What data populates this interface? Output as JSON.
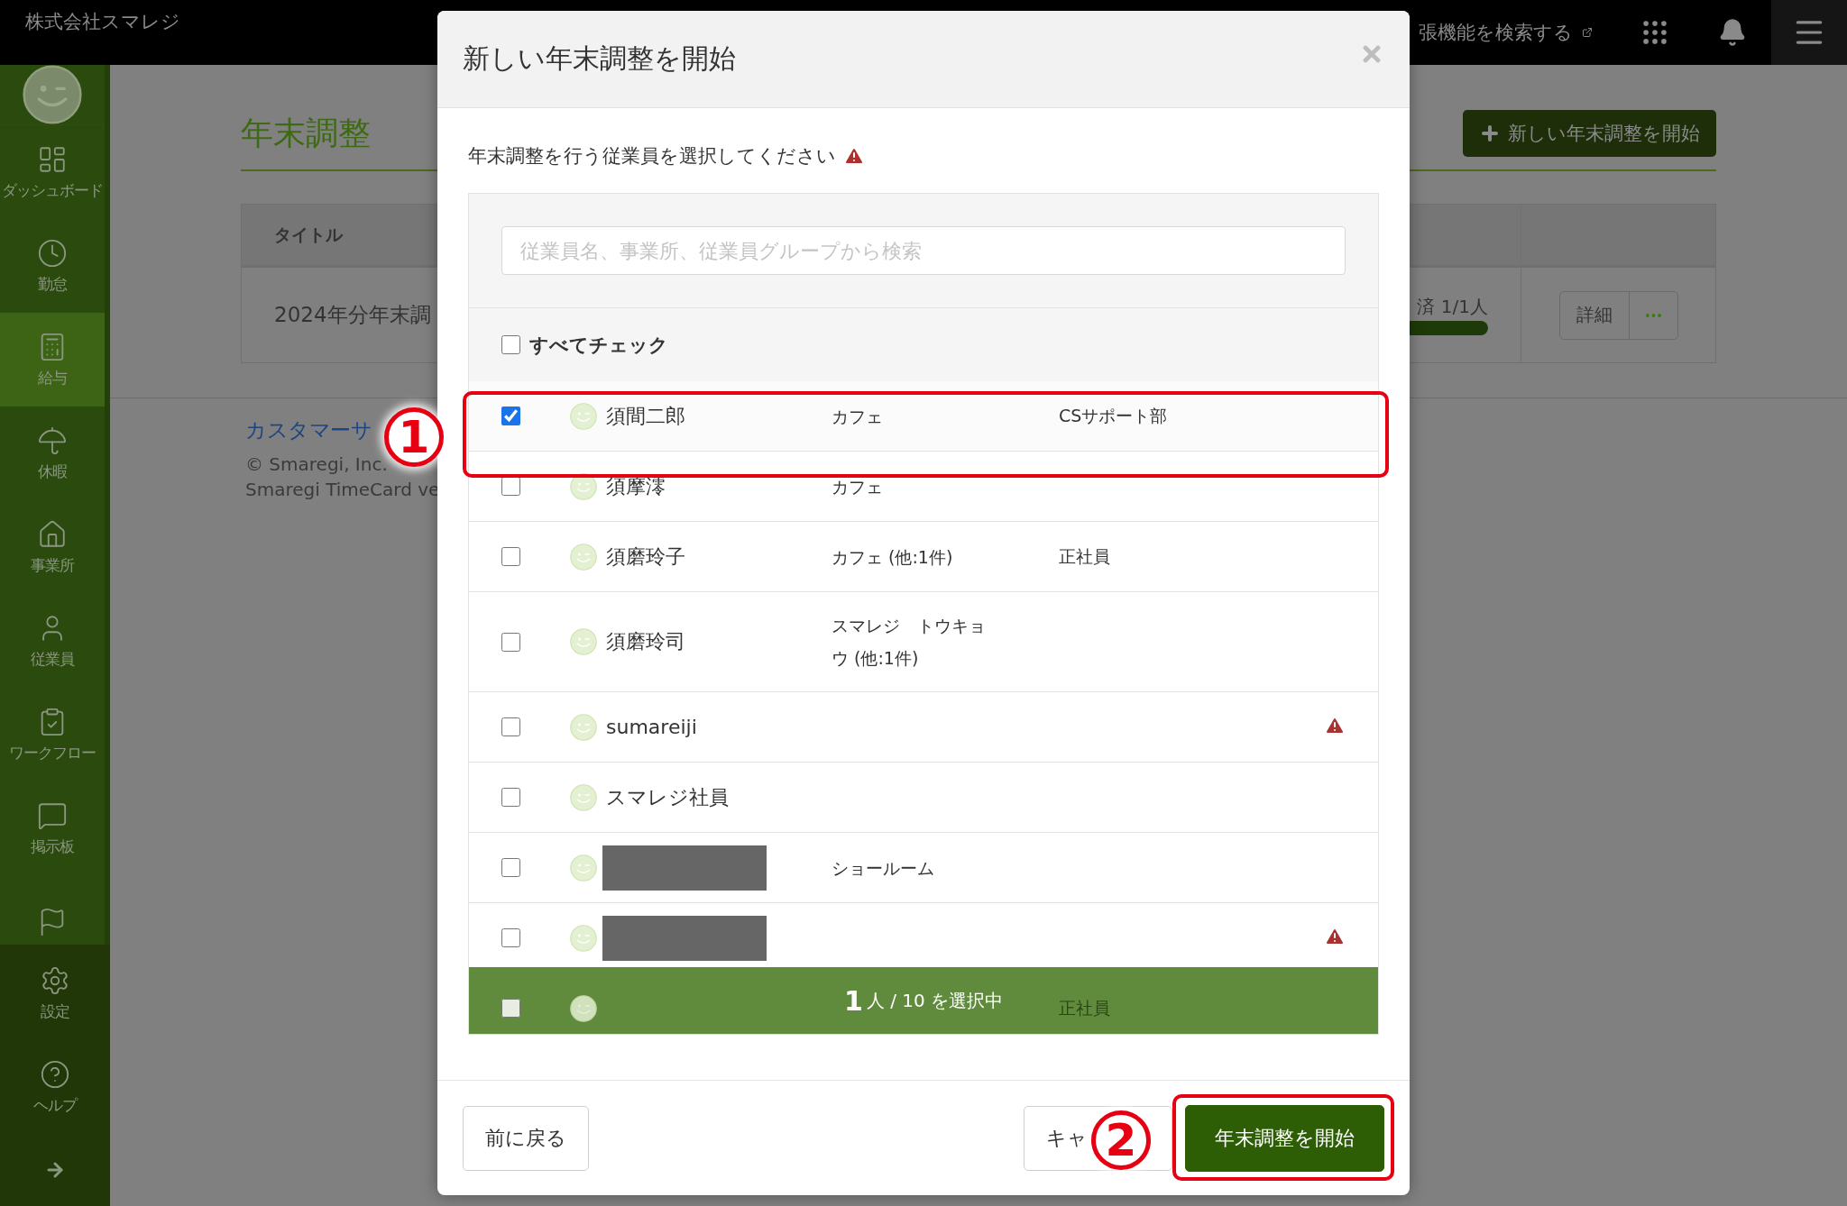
{
  "topbar": {
    "company": "株式会社スマレジ",
    "extension_search": "張機能を検索する"
  },
  "sidebar": {
    "items": [
      {
        "label": "ダッシュボード",
        "selected": false
      },
      {
        "label": "勤怠",
        "selected": false
      },
      {
        "label": "給与",
        "selected": true
      },
      {
        "label": "休暇",
        "selected": false
      },
      {
        "label": "事業所",
        "selected": false
      },
      {
        "label": "従業員",
        "selected": false
      },
      {
        "label": "ワークフロー",
        "selected": false
      },
      {
        "label": "掲示板",
        "selected": false
      }
    ],
    "bottom_items": [
      {
        "label": "設定"
      },
      {
        "label": "ヘルプ"
      }
    ]
  },
  "page": {
    "title": "年末調整",
    "new_button": "新しい年末調整を開始",
    "table": {
      "columns": [
        "タイトル"
      ],
      "rows": [
        {
          "title": "2024年分年末調",
          "progress_text": "済 1/1人",
          "level": 1,
          "detail_button": "詳細"
        }
      ]
    },
    "footer": {
      "support_link": "カスタマーサ",
      "copyright": "© Smaregi, Inc.",
      "version": "Smaregi TimeCard ve"
    }
  },
  "modal": {
    "title": "新しい年末調整を開始",
    "instruction": "年末調整を行う従業員を選択してください",
    "search": {
      "placeholder": "従業員名、事業所、従業員グループから検索"
    },
    "check_all": {
      "label": "すべてチェック",
      "checked": false
    },
    "employees": [
      {
        "kind": "named",
        "checked": true,
        "name": "須間二郎",
        "store": "カフェ",
        "group": "CSサポート部",
        "warning": false
      },
      {
        "kind": "named",
        "checked": false,
        "name": "須摩澪",
        "store": "カフェ",
        "warning": false
      },
      {
        "kind": "named",
        "checked": false,
        "name": "須磨玲子",
        "store": "カフェ (他:1件)",
        "group": "正社員",
        "warning": false
      },
      {
        "kind": "named",
        "checked": false,
        "name": "須磨玲司",
        "store": "スマレジ　トウキョウ (他:1件)",
        "warning": false
      },
      {
        "kind": "named",
        "checked": false,
        "name": "sumareiji",
        "warning": true
      },
      {
        "kind": "named",
        "checked": false,
        "name": "スマレジ社員",
        "warning": false
      },
      {
        "kind": "redacted",
        "checked": false,
        "store": "ショールーム",
        "warning": false
      },
      {
        "kind": "redacted",
        "checked": false,
        "warning": true
      },
      {
        "kind": "covered",
        "checked": false,
        "group": "正社員",
        "warning": false
      }
    ],
    "selection_summary": {
      "count": "1",
      "text": "人 / 10 を選択中"
    },
    "buttons": {
      "back": "前に戻る",
      "cancel": "キャ",
      "start": "年末調整を開始"
    }
  },
  "annotations": [
    {
      "kind": "frame"
    },
    {
      "kind": "marker",
      "label": "1"
    },
    {
      "kind": "frame"
    },
    {
      "kind": "marker",
      "label": "2"
    }
  ]
}
